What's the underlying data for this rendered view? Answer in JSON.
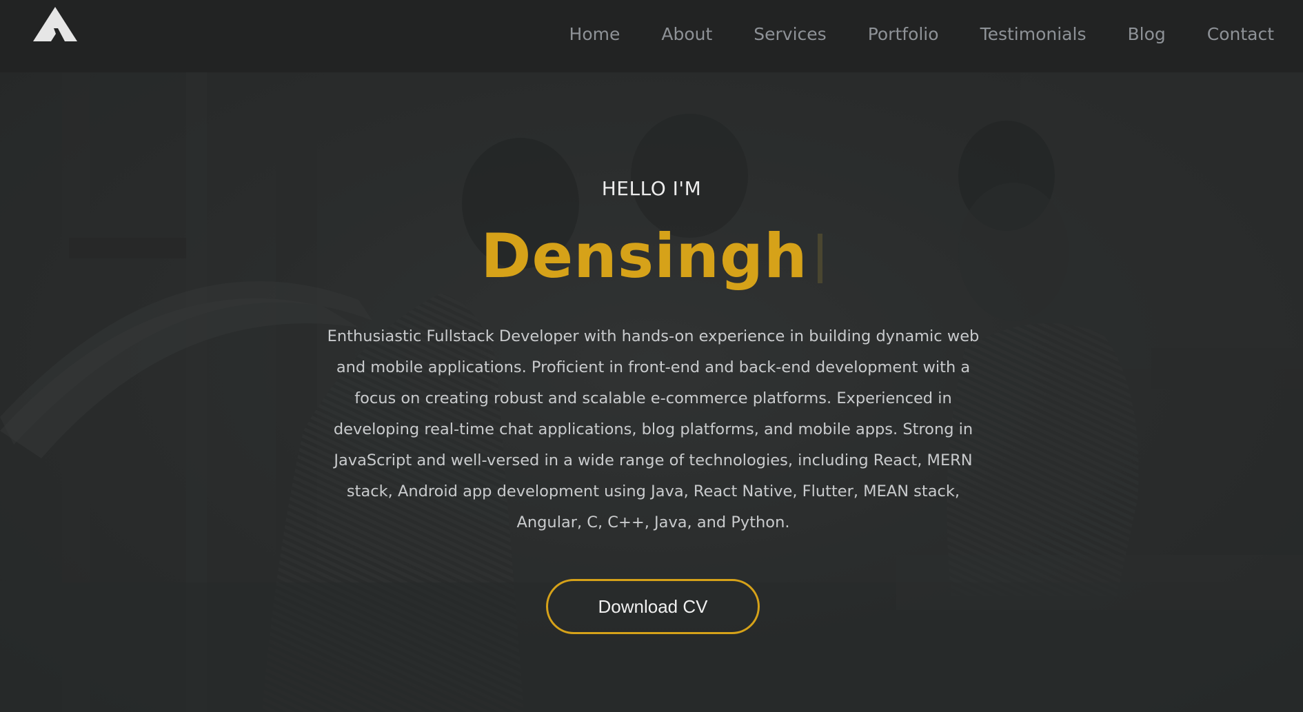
{
  "brand": {
    "logo_icon": "triangle-a-logo-icon"
  },
  "nav": {
    "items": [
      {
        "label": "Home"
      },
      {
        "label": "About"
      },
      {
        "label": "Services"
      },
      {
        "label": "Portfolio"
      },
      {
        "label": "Testimonials"
      },
      {
        "label": "Blog"
      },
      {
        "label": "Contact"
      }
    ]
  },
  "hero": {
    "greeting": "HELLO I'M",
    "name": "Densingh",
    "description": "Enthusiastic Fullstack Developer with hands-on experience in building dynamic web and mobile applications. Proficient in front-end and back-end development with a focus on creating robust and scalable e-commerce platforms. Experienced in developing real-time chat applications, blog platforms, and mobile apps. Strong in JavaScript and well-versed in a wide range of technologies, including React, MERN stack, Android app development using Java, React Native, Flutter, MEAN stack, Angular, C, C++, Java, and Python.",
    "cta_label": "Download CV"
  },
  "colors": {
    "accent": "#d6a219",
    "navbar_bg": "#222323",
    "hero_bg": "#2b2d2d",
    "nav_text": "#8e9297",
    "body_text": "#c9cbcd"
  }
}
